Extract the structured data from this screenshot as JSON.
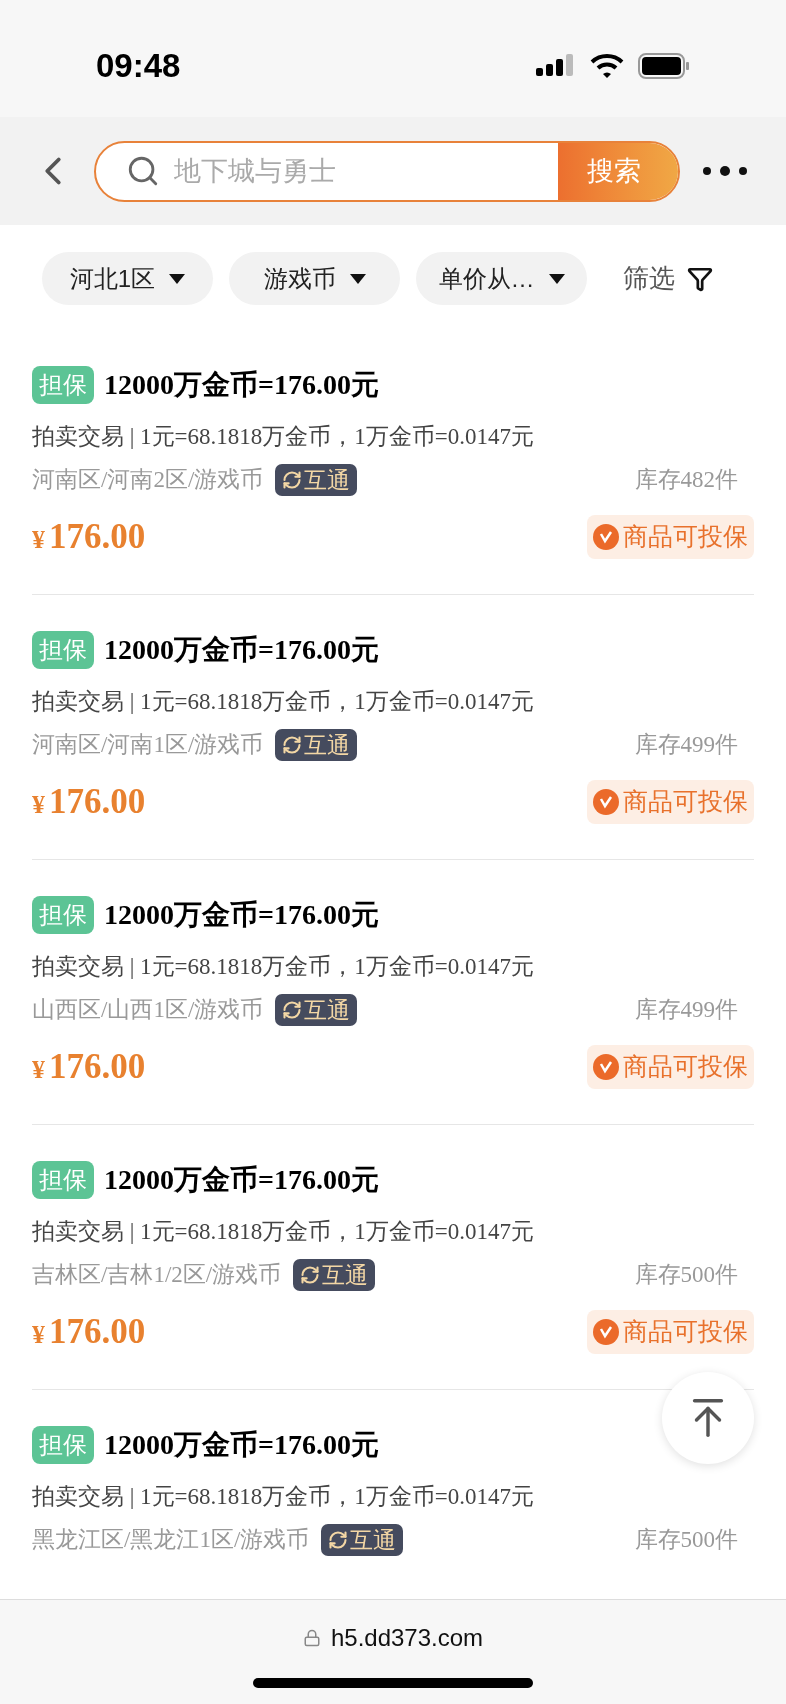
{
  "status_bar": {
    "time": "09:48"
  },
  "search": {
    "placeholder": "地下城与勇士",
    "button": "搜索"
  },
  "filters": [
    {
      "label": "河北1区"
    },
    {
      "label": "游戏币"
    },
    {
      "label": "单价从…"
    }
  ],
  "filter_button": "筛选",
  "listings": [
    {
      "badge": "担保",
      "title": "12000万金币=176.00元",
      "detail": "拍卖交易 | 1元=68.1818万金币，1万金币=0.0147元",
      "location": "河南区/河南2区/游戏币",
      "tag": "互通",
      "stock": "库存482件",
      "currency": "¥",
      "amount": "176.00",
      "guarantee": "商品可投保"
    },
    {
      "badge": "担保",
      "title": "12000万金币=176.00元",
      "detail": "拍卖交易 | 1元=68.1818万金币，1万金币=0.0147元",
      "location": "河南区/河南1区/游戏币",
      "tag": "互通",
      "stock": "库存499件",
      "currency": "¥",
      "amount": "176.00",
      "guarantee": "商品可投保"
    },
    {
      "badge": "担保",
      "title": "12000万金币=176.00元",
      "detail": "拍卖交易 | 1元=68.1818万金币，1万金币=0.0147元",
      "location": "山西区/山西1区/游戏币",
      "tag": "互通",
      "stock": "库存499件",
      "currency": "¥",
      "amount": "176.00",
      "guarantee": "商品可投保"
    },
    {
      "badge": "担保",
      "title": "12000万金币=176.00元",
      "detail": "拍卖交易 | 1元=68.1818万金币，1万金币=0.0147元",
      "location": "吉林区/吉林1/2区/游戏币",
      "tag": "互通",
      "stock": "库存500件",
      "currency": "¥",
      "amount": "176.00",
      "guarantee": "商品可投保"
    },
    {
      "badge": "担保",
      "title": "12000万金币=176.00元",
      "detail": "拍卖交易 | 1元=68.1818万金币，1万金币=0.0147元",
      "location": "黑龙江区/黑龙江1区/游戏币",
      "tag": "互通",
      "stock": "库存500件"
    }
  ],
  "browser": {
    "url": "h5.dd373.com"
  }
}
